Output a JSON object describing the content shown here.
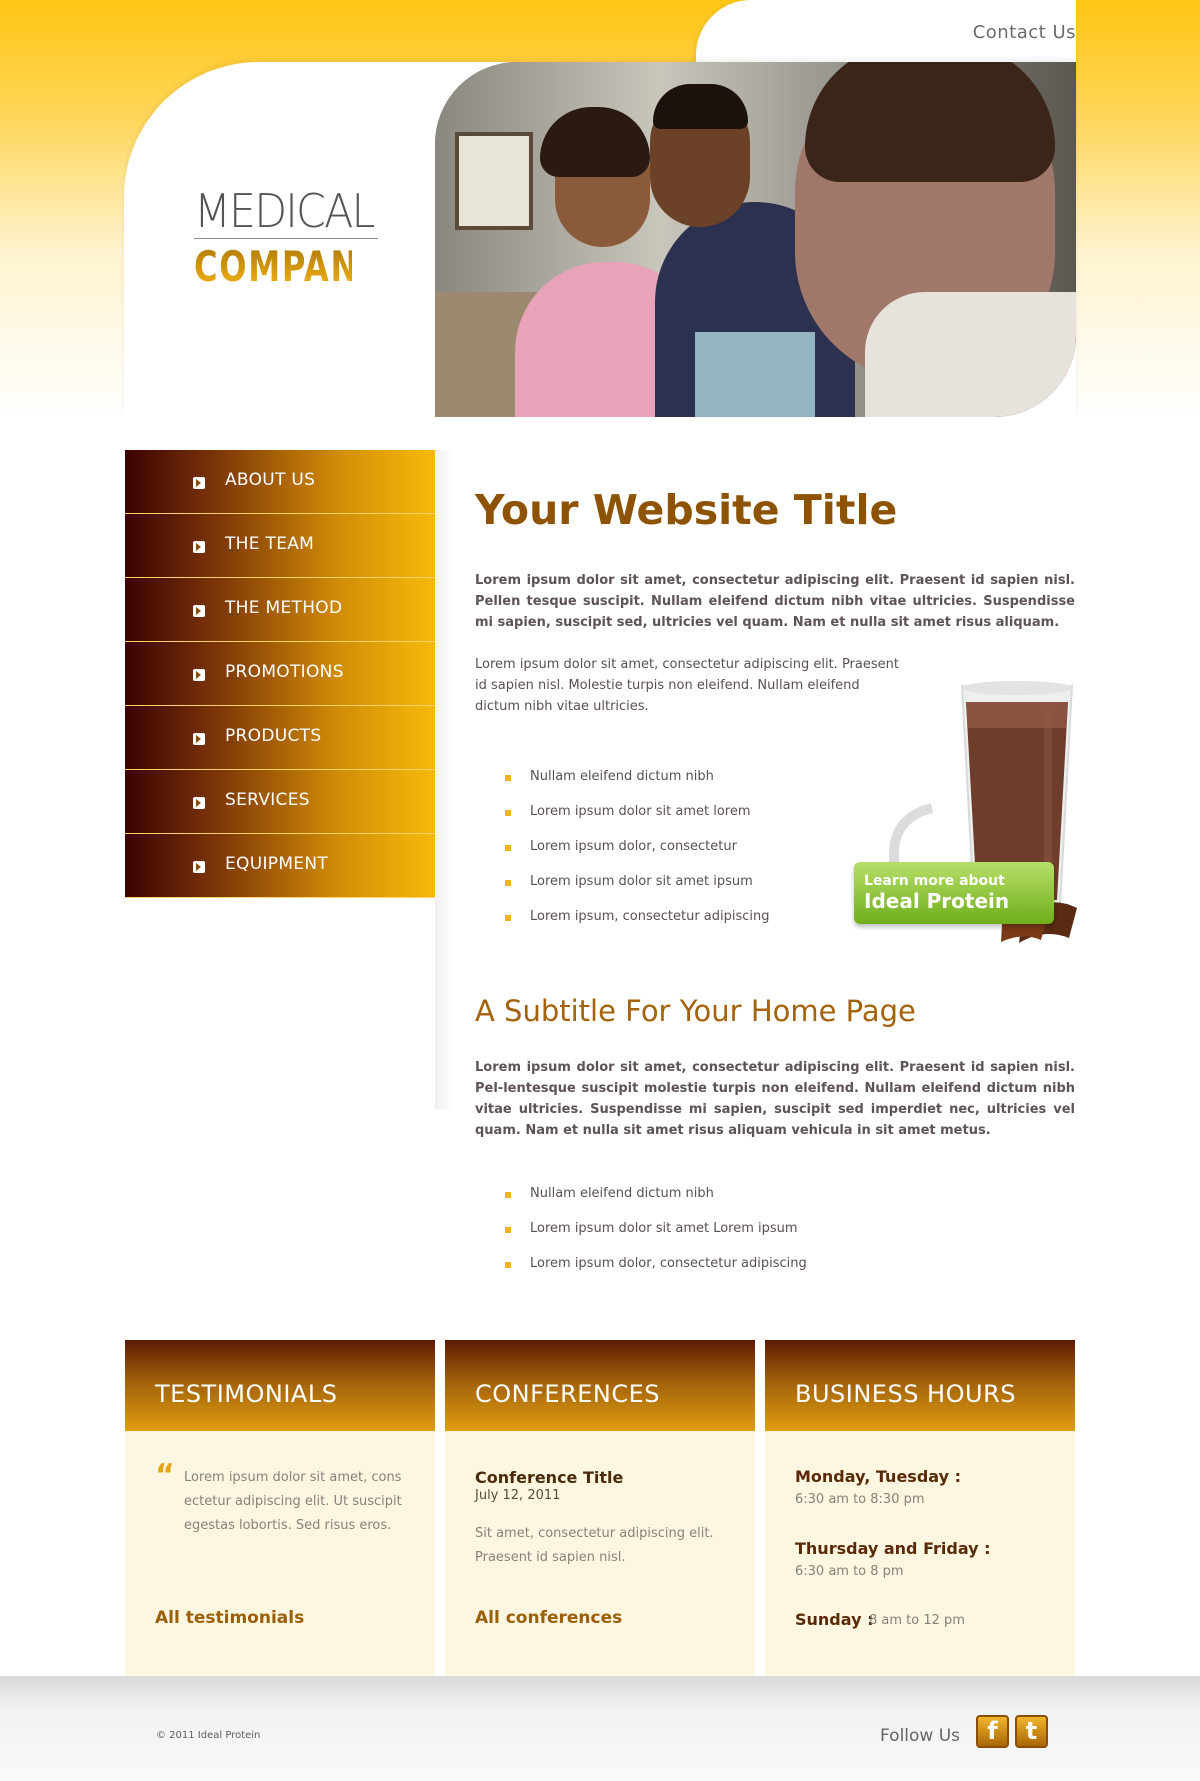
{
  "header": {
    "contact_label": "Contact Us",
    "logo_top": "MEDICAL",
    "logo_bottom": "COMPANY"
  },
  "nav": {
    "items": [
      {
        "label": "ABOUT US"
      },
      {
        "label": "THE TEAM"
      },
      {
        "label": "THE METHOD"
      },
      {
        "label": "PROMOTIONS"
      },
      {
        "label": "PRODUCTS"
      },
      {
        "label": "SERVICES"
      },
      {
        "label": "EQUIPMENT"
      }
    ]
  },
  "main": {
    "title": "Your Website Title",
    "p1": "Lorem ipsum dolor sit amet, consectetur adipiscing elit. Praesent id sapien nisl. Pellen tesque suscipit. Nullam eleifend dictum nibh vitae ultricies. Suspendisse mi sapien, suscipit sed, ultricies vel quam. Nam et nulla sit amet risus aliquam.",
    "p2": "Lorem ipsum dolor sit amet, consectetur adipiscing elit. Praesent id sapien nisl. Molestie turpis non eleifend. Nullam eleifend dictum nibh vitae ultricies.",
    "list1": [
      "Nullam eleifend dictum nibh",
      "Lorem ipsum dolor sit amet lorem",
      "Lorem ipsum dolor, consectetur",
      "Lorem ipsum dolor sit amet ipsum",
      "Lorem ipsum, consectetur adipiscing"
    ],
    "subtitle": "A Subtitle For Your Home Page",
    "p3": "Lorem ipsum dolor sit amet, consectetur adipiscing elit. Praesent id sapien nisl. Pel-lentesque suscipit molestie turpis non eleifend. Nullam eleifend dictum nibh vitae ultricies. Suspendisse mi sapien, suscipit sed imperdiet nec, ultricies vel quam. Nam et nulla sit amet risus aliquam vehicula in sit amet metus.",
    "list2": [
      "Nullam eleifend dictum nibh",
      "Lorem ipsum dolor sit amet Lorem ipsum",
      "Lorem ipsum dolor, consectetur adipiscing"
    ],
    "promo_line1": "Learn more about",
    "promo_line2": "Ideal Protein"
  },
  "boxes": {
    "testimonials": {
      "title": "TESTIMONIALS",
      "quote_mark": "“",
      "text": "Lorem ipsum dolor sit amet, cons ectetur adipiscing elit. Ut suscipit egestas lobortis. Sed risus eros.",
      "link": "All testimonials"
    },
    "conferences": {
      "title": "CONFERENCES",
      "conf_title": "Conference Title",
      "conf_date": "July 12, 2011",
      "text": "Sit amet, consectetur adipiscing elit. Praesent id sapien nisl.",
      "link": "All conferences"
    },
    "hours": {
      "title": "BUSINESS HOURS",
      "day1": "Monday, Tuesday :",
      "time1": "6:30 am to 8:30 pm",
      "day2": "Thursday and Friday :",
      "time2": "6:30 am to 8 pm",
      "day3": "Sunday :",
      "time3": "8 am to 12 pm"
    }
  },
  "footer": {
    "copyright": "© 2011 Ideal Protein",
    "follow": "Follow Us",
    "facebook_glyph": "f",
    "twitter_glyph": "t"
  },
  "colors": {
    "brand_gold": "#ffc514",
    "brand_brown": "#8e5300",
    "nav_dark": "#3a0203",
    "promo_green": "#6fae1a"
  }
}
